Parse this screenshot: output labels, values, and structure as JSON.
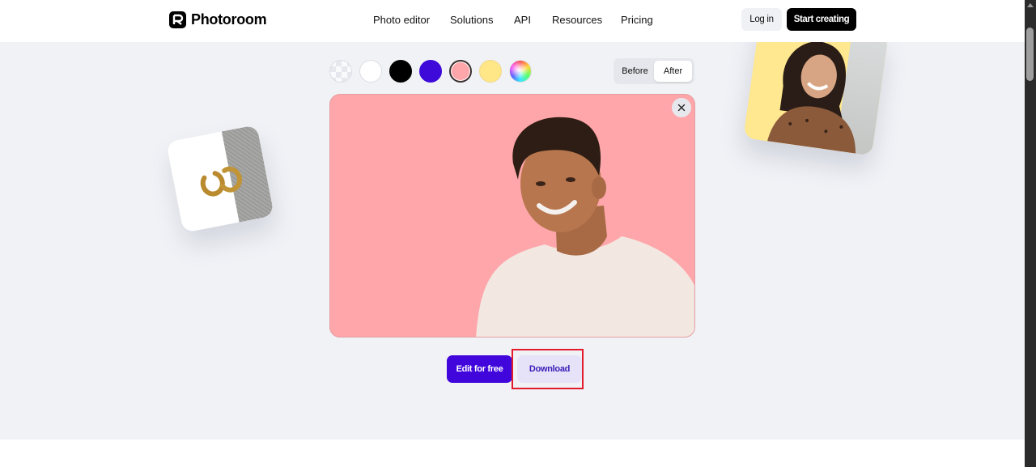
{
  "header": {
    "brand": "Photoroom",
    "nav": [
      "Photo editor",
      "Solutions",
      "API",
      "Resources",
      "Pricing"
    ],
    "login_label": "Log in",
    "start_label": "Start creating"
  },
  "editor": {
    "background_swatches": [
      {
        "name": "transparent",
        "color": "checkerboard"
      },
      {
        "name": "white",
        "color": "#ffffff"
      },
      {
        "name": "black",
        "color": "#000000"
      },
      {
        "name": "purple",
        "color": "#3d0ad9"
      },
      {
        "name": "pink",
        "color": "#fea6aa",
        "selected": true
      },
      {
        "name": "yellow",
        "color": "#ffe686"
      },
      {
        "name": "custom-color",
        "color": "rainbow"
      }
    ],
    "toggle": {
      "before_label": "Before",
      "after_label": "After",
      "active": "After"
    },
    "stage_background": "#fea6aa",
    "close_icon": "close-icon"
  },
  "actions": {
    "edit_label": "Edit for free",
    "download_label": "Download"
  },
  "colors": {
    "brand_purple": "#4006dc",
    "highlight_red": "#e31b2a",
    "hero_bg": "#f1f2f6"
  }
}
